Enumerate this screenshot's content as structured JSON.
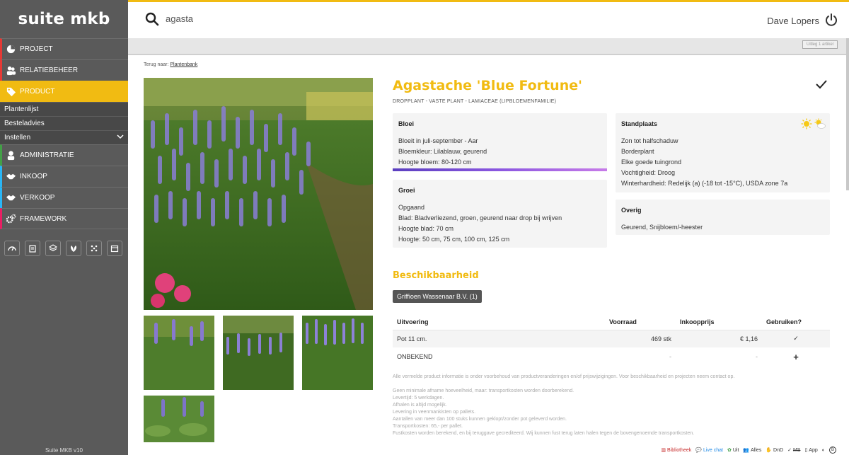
{
  "app": {
    "brand": "suite mkb",
    "version": "Suite MKB v10"
  },
  "sidebar": {
    "items": [
      {
        "label": "PROJECT",
        "color": "#e53935",
        "icon": "chart-pie-icon"
      },
      {
        "label": "RELATIEBEHEER",
        "color": "#e53935",
        "icon": "people-icon"
      },
      {
        "label": "PRODUCT",
        "color": "#f1bb12",
        "icon": "tag-icon",
        "active": true
      },
      {
        "label": "ADMINISTRATIE",
        "color": "#43a047",
        "icon": "user-icon"
      },
      {
        "label": "INKOOP",
        "color": "#29b6f6",
        "icon": "handshake-icon"
      },
      {
        "label": "VERKOOP",
        "color": "#29b6f6",
        "icon": "handshake-icon"
      },
      {
        "label": "FRAMEWORK",
        "color": "#e91e63",
        "icon": "gears-icon"
      }
    ],
    "subitems": [
      "Plantenlijst",
      "Besteladvies",
      "Instellen"
    ],
    "tools": [
      "dashboard-icon",
      "clipboard-icon",
      "layers-icon",
      "leaf-icon",
      "scatter-icon",
      "calendar-icon"
    ]
  },
  "topbar": {
    "search_value": "agasta",
    "user": "Dave Lopers"
  },
  "greybar": {
    "uitleg": "Uitleg 1 artikel"
  },
  "breadcrumb": {
    "prefix": "Terug naar:",
    "link": "Plantenbank"
  },
  "product": {
    "title": "Agastache 'Blue Fortune'",
    "subtitle": "DROPPLANT - VASTE PLANT - LAMIACEAE (LIPBLOEMENFAMILIE)",
    "bloei": {
      "heading": "Bloei",
      "lines": [
        "Bloeit in juli-september - Aar",
        "Bloemkleur: Lilablauw, geurend",
        "Hoogte bloem: 80-120 cm"
      ]
    },
    "groei": {
      "heading": "Groei",
      "lines": [
        "Opgaand",
        "Blad: Bladverliezend, groen, geurend naar drop bij wrijven",
        "Hoogte blad: 70 cm",
        "Hoogte: 50 cm, 75 cm, 100 cm, 125 cm"
      ]
    },
    "standplaats": {
      "heading": "Standplaats",
      "lines": [
        "Zon tot halfschaduw",
        "Borderplant",
        "Elke goede tuingrond",
        "Vochtigheid: Droog",
        "Winterhardheid: Redelijk (a) (-18 tot -15°C), USDA zone 7a"
      ]
    },
    "overig": {
      "heading": "Overig",
      "lines": [
        "Geurend, Snijbloem/-heester"
      ]
    }
  },
  "availability": {
    "title": "Beschikbaarheid",
    "supplier": "Griffioen Wassenaar B.V. (1)",
    "headers": [
      "Uitvoering",
      "Voorraad",
      "Inkoopprijs",
      "Gebruiken?"
    ],
    "rows": [
      {
        "uitvoering": "Pot 11 cm.",
        "voorraad": "469 stk",
        "prijs": "€ 1,16",
        "action": "✓"
      },
      {
        "uitvoering": "ONBEKEND",
        "voorraad": "-",
        "prijs": "-",
        "action": "+"
      }
    ]
  },
  "disclaimer": {
    "main": "Alle vermelde product informatie is onder voorbehoud van productveranderingen en/of prijswijzigingen. Voor beschikbaarheid en projecten neem contact op.",
    "lines": [
      "Geen minimale afname hoeveelheid, maar: transportkosten worden doorberekend.",
      "Levertijd: 5 werkdagen.",
      "Afhalen is altijd mogelijk.",
      "Levering in veenmankisten op pallets.",
      "Aantallen van meer dan 100 stuks kunnen geklopt/zonder pot geleverd worden.",
      "Transportkosten: 65,- per pallet.",
      "Fustkosten worden berekend, en bij teruggave gecrediteerd. Wij kunnen fust terug laten halen tegen de bovengenoemde transportkosten."
    ]
  },
  "footer": {
    "links": [
      "Bibliotheek",
      "Live chat",
      "Uit",
      "Alles",
      "DnD",
      "MS",
      "App"
    ]
  }
}
